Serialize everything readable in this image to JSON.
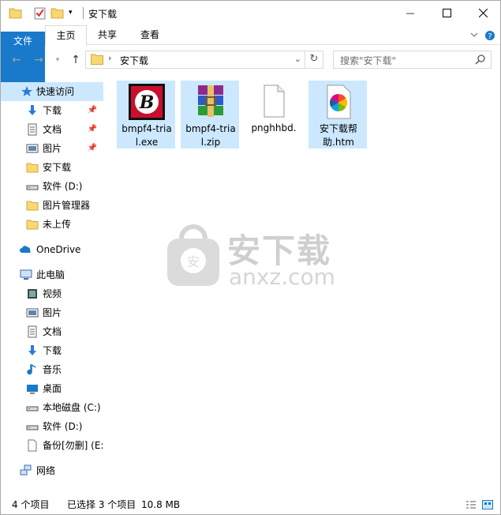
{
  "window": {
    "title": "安下载",
    "controls": {
      "minimize": "—",
      "maximize": "☐",
      "close": "✕"
    }
  },
  "ribbon": {
    "tabs": [
      "文件",
      "主页",
      "共享",
      "查看"
    ],
    "expand_icon": "chevron-down-icon",
    "help_icon": "help-icon"
  },
  "address": {
    "path_item": "安下载",
    "search_placeholder": "搜索\"安下载\""
  },
  "nav": {
    "quick_access": "快速访问",
    "quick_items": [
      {
        "label": "下载",
        "icon": "download-icon",
        "pinned": true
      },
      {
        "label": "文档",
        "icon": "document-icon",
        "pinned": true
      },
      {
        "label": "图片",
        "icon": "picture-icon",
        "pinned": true
      },
      {
        "label": "安下载",
        "icon": "folder-icon",
        "pinned": false
      },
      {
        "label": "软件 (D:)",
        "icon": "drive-icon",
        "pinned": false
      },
      {
        "label": "图片管理器",
        "icon": "folder-icon",
        "pinned": false
      },
      {
        "label": "未上传",
        "icon": "folder-icon",
        "pinned": false
      }
    ],
    "onedrive": "OneDrive",
    "this_pc": "此电脑",
    "pc_items": [
      {
        "label": "视频",
        "icon": "video-icon"
      },
      {
        "label": "图片",
        "icon": "picture-icon"
      },
      {
        "label": "文档",
        "icon": "document-icon"
      },
      {
        "label": "下载",
        "icon": "download-icon"
      },
      {
        "label": "音乐",
        "icon": "music-icon"
      },
      {
        "label": "桌面",
        "icon": "desktop-icon"
      },
      {
        "label": "本地磁盘 (C:)",
        "icon": "drive-icon"
      },
      {
        "label": "软件 (D:)",
        "icon": "drive-icon"
      },
      {
        "label": "备份[勿删] (E:",
        "icon": "blank-drive-icon"
      }
    ],
    "network": "网络"
  },
  "files": [
    {
      "name": "bmpf4-trial.exe",
      "line1": "bmpf4-tria",
      "line2": "l.exe",
      "icon": "bitdefender-app-icon",
      "selected": true
    },
    {
      "name": "bmpf4-trial.zip",
      "line1": "bmpf4-tria",
      "line2": "l.zip",
      "icon": "winrar-archive-icon",
      "selected": true
    },
    {
      "name": "pnghhbd.",
      "line1": "pnghhbd.",
      "line2": "",
      "icon": "blank-file-icon",
      "selected": false
    },
    {
      "name": "安下载帮助.htm",
      "line1": "安下载帮",
      "line2": "助.htm",
      "icon": "htm-file-icon",
      "selected": true
    }
  ],
  "watermark": {
    "cn": "安下载",
    "en": "anxz.com"
  },
  "status": {
    "count": "4 个项目",
    "selected": "已选择 3 个项目",
    "size": "10.8 MB"
  },
  "colors": {
    "accent": "#1979ca",
    "selection": "#cce8ff",
    "folder": "#f8d775"
  }
}
